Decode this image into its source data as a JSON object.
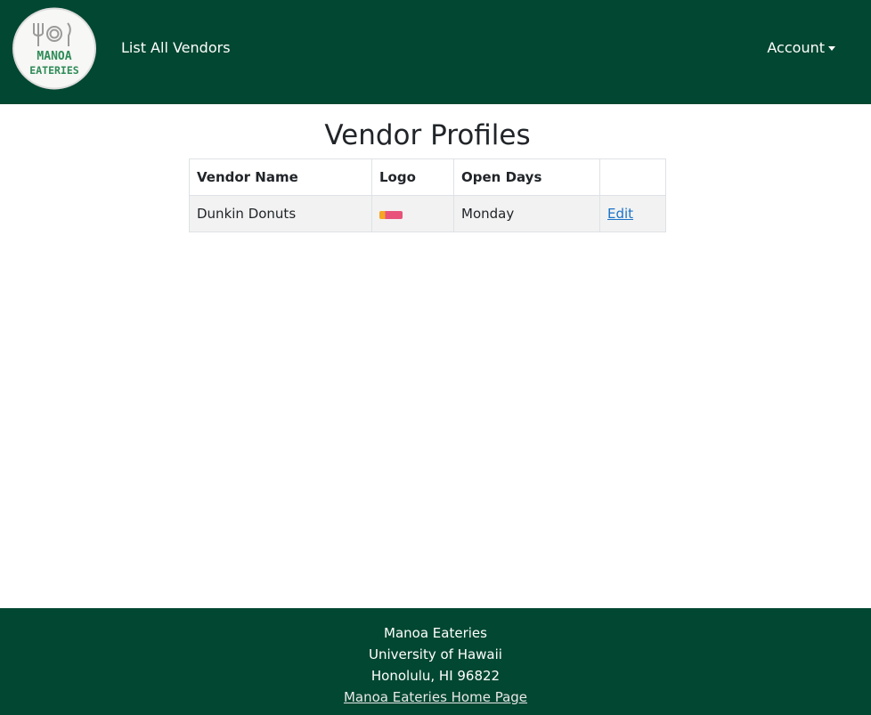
{
  "navbar": {
    "logo_text_top": "MANOA",
    "logo_text_bottom": "EATERIES",
    "list_vendors_label": "List All Vendors",
    "account_label": "Account"
  },
  "main": {
    "title": "Vendor Profiles",
    "table": {
      "headers": [
        "Vendor Name",
        "Logo",
        "Open Days",
        ""
      ],
      "rows": [
        {
          "name": "Dunkin Donuts",
          "logo_icon": "dunkin-logo-thumbnail",
          "open_days": "Monday",
          "action": "Edit"
        }
      ]
    }
  },
  "footer": {
    "line1": "Manoa Eateries",
    "line2": "University of Hawaii",
    "line3": "Honolulu, HI 96822",
    "link": "Manoa Eateries Home Page"
  },
  "colors": {
    "brand_green": "#024731",
    "logo_green": "#2e8b57",
    "link_blue": "#1a73c8"
  }
}
